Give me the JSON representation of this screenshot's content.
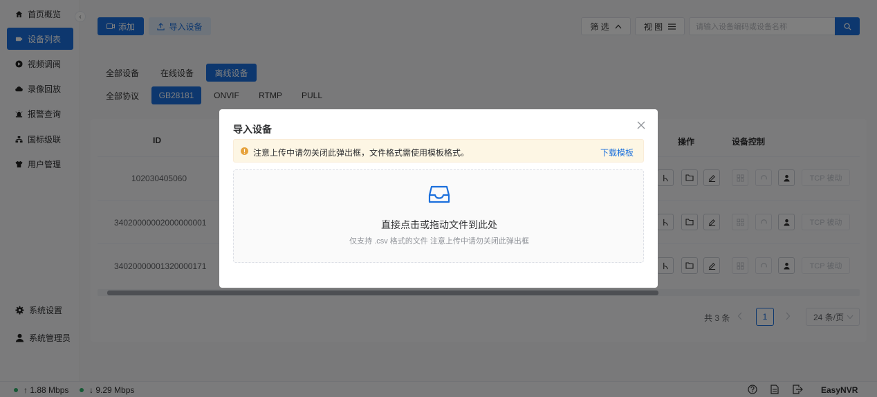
{
  "sidebar": {
    "items": [
      {
        "label": "首页概览",
        "icon": "home-icon"
      },
      {
        "label": "设备列表",
        "icon": "device-icon",
        "active": true
      },
      {
        "label": "视频调阅",
        "icon": "play-circle-icon"
      },
      {
        "label": "录像回放",
        "icon": "cloud-icon"
      },
      {
        "label": "报警查询",
        "icon": "alarm-icon"
      },
      {
        "label": "国标级联",
        "icon": "cascade-icon"
      },
      {
        "label": "用户管理",
        "icon": "shirt-icon"
      }
    ],
    "bottom_items": [
      {
        "label": "系统设置",
        "icon": "gear-icon"
      },
      {
        "label": "系统管理员",
        "icon": "user-icon"
      }
    ],
    "collapse_glyph": "‹"
  },
  "toolbar": {
    "add_label": "添加",
    "import_label": "导入设备",
    "filter_label": "筛 选",
    "view_label": "视 图",
    "search_placeholder": "请输入设备编码或设备名称"
  },
  "filters": {
    "status_tabs": [
      "全部设备",
      "在线设备",
      "离线设备"
    ],
    "status_selected": "离线设备",
    "protocol_tabs": [
      "全部协议",
      "GB28181",
      "ONVIF",
      "RTMP",
      "PULL"
    ],
    "protocol_selected": "GB28181"
  },
  "table": {
    "headers": {
      "id": "ID",
      "ops": "操作",
      "control": "设备控制"
    },
    "rows": [
      {
        "id": "102030405060",
        "tcp": "TCP 被动"
      },
      {
        "id": "34020000002000000001",
        "tcp": "TCP 被动"
      },
      {
        "id": "34020000001320000171",
        "tcp": "TCP 被动"
      }
    ]
  },
  "pager": {
    "total": "共 3 条",
    "current": "1",
    "page_size": "24 条/页"
  },
  "statusbar": {
    "upload": "↑ 1.88 Mbps",
    "download": "↓ 9.29 Mbps",
    "brand": "EasyNVR"
  },
  "modal": {
    "title": "导入设备",
    "alert_text": "注意上传中请勿关闭此弹出框，文件格式需使用模板格式。",
    "download_template": "下载模板",
    "drop_main": "直接点击或拖动文件到此处",
    "drop_sub": "仅支持 .csv 格式的文件 注意上传中请勿关闭此弹出框"
  },
  "colors": {
    "accent": "#1a6fdc",
    "warning": "#e6a23c",
    "online": "#2fb36a"
  }
}
